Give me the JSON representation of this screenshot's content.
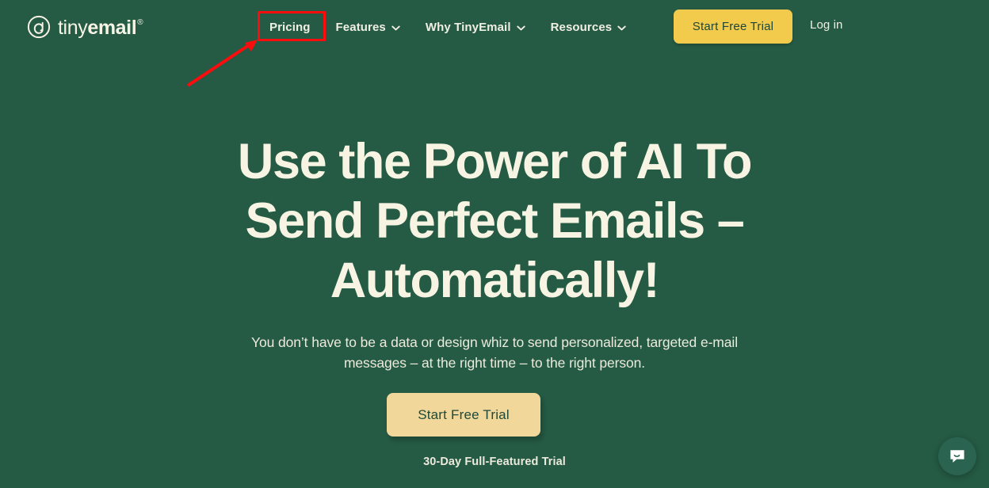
{
  "page": {
    "background_color": "#255a44",
    "text_cream": "#f7f4e3"
  },
  "nav": {
    "logo": {
      "icon": "at-circle-icon",
      "text_light": "tiny",
      "text_bold": "email",
      "registered_mark": "®"
    },
    "links": [
      {
        "label": "Pricing",
        "has_dropdown": false,
        "chevron": "chevron-down-icon"
      },
      {
        "label": "Features",
        "has_dropdown": true,
        "chevron": "chevron-down-icon"
      },
      {
        "label": "Why TinyEmail",
        "has_dropdown": true,
        "chevron": "chevron-down-icon"
      },
      {
        "label": "Resources",
        "has_dropdown": true,
        "chevron": "chevron-down-icon"
      }
    ],
    "cta_label": "Start Free Trial",
    "cta_color": "#f3cb4c",
    "login_label": "Log in"
  },
  "hero": {
    "headline_lines": [
      "Use the Power of AI To",
      "Send Perfect Emails –",
      "Automatically!"
    ],
    "subhead_lines": [
      "You don’t have to be a data or design whiz to send personalized, targeted e-mail",
      "messages – at the right time – to the right person."
    ],
    "cta_label": "Start Free Trial",
    "cta_color": "#f2d79b",
    "note": "30-Day Full-Featured Trial"
  },
  "chat_widget": {
    "icon": "chat-message-icon",
    "color": "#2a6450"
  },
  "annotation": {
    "color": "#fb0d0d",
    "target_label": "Pricing",
    "shape": "rectangle-with-arrow"
  }
}
